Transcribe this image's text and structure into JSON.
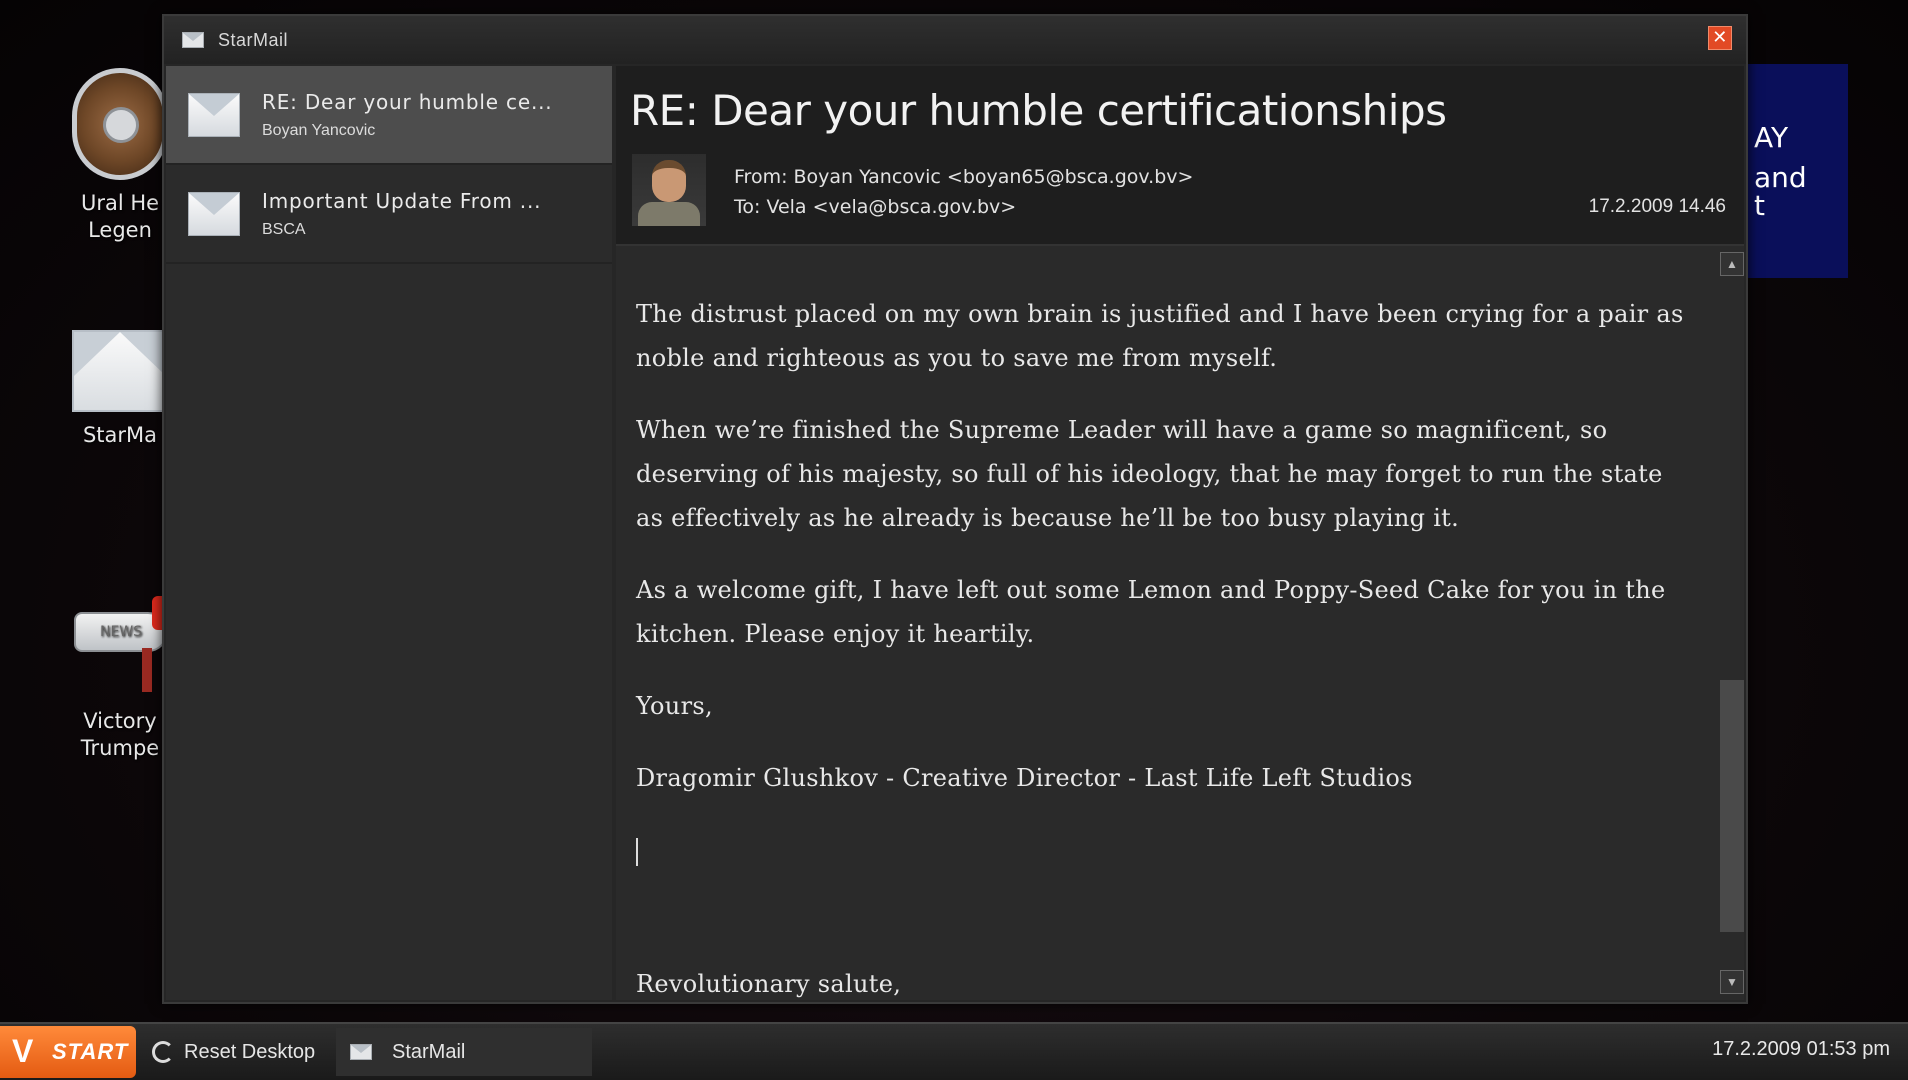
{
  "desktop": {
    "icons": [
      {
        "label_line1": "Ural He",
        "label_line2": "Legen"
      },
      {
        "label_line1": "StarMa",
        "label_line2": ""
      },
      {
        "label_line1": "Victory",
        "label_line2": "Trumpe"
      }
    ],
    "mailbox_text": "NEWS",
    "bg_window_text": {
      "line1": "AY",
      "line2": "and",
      "line3": "t"
    }
  },
  "window": {
    "title": "StarMail",
    "close_glyph": "✕"
  },
  "mail_list": [
    {
      "subject": "RE: Dear your humble ce...",
      "sender": "Boyan Yancovic",
      "selected": true
    },
    {
      "subject": "Important Update From ...",
      "sender": "BSCA",
      "selected": false
    }
  ],
  "reader": {
    "subject": "RE: Dear your humble certificationships",
    "from": "From: Boyan Yancovic <boyan65@bsca.gov.bv>",
    "to": "To: Vela <vela@bsca.gov.bv>",
    "date": "17.2.2009 14.46",
    "body": [
      "The distrust placed on my own brain is justified and I have been crying for a pair as noble and righteous as you to save me from myself.",
      "When we’re finished the Supreme Leader will have a game so magnificent, so deserving of his majesty, so full of his ideology, that he may forget to run the state as effectively as he already is because he’ll be too busy playing it.",
      "As a welcome gift, I have left out some Lemon and Poppy-Seed Cake for you in the kitchen. Please enjoy it heartily.",
      "Yours,",
      "Dragomir Glushkov - Creative Director - Last Life Left Studios"
    ],
    "closing": "Revolutionary salute,"
  },
  "taskbar": {
    "start_label": "START",
    "start_logo": "V",
    "reset_label": "Reset Desktop",
    "task_label": "StarMail",
    "clock": "17.2.2009 01:53 pm"
  },
  "colors": {
    "start": "#e45b12",
    "close": "#e24a25",
    "selected_item": "#4d4d4d"
  }
}
